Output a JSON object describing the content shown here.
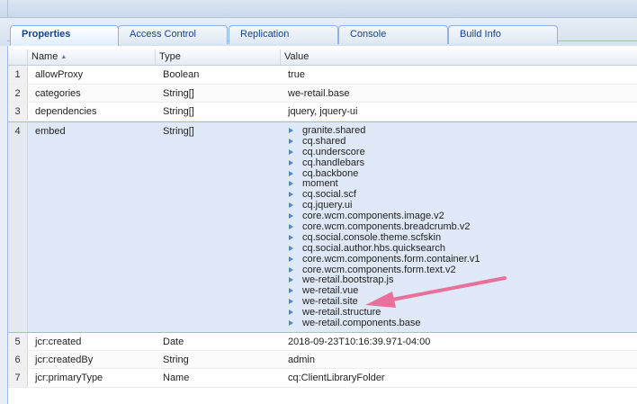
{
  "tabs": [
    {
      "label": "Properties",
      "active": true
    },
    {
      "label": "Access Control"
    },
    {
      "label": "Replication"
    },
    {
      "label": "Console"
    },
    {
      "label": "Build Info"
    }
  ],
  "columns": {
    "name": "Name",
    "type": "Type",
    "value": "Value"
  },
  "rows": [
    {
      "num": "1",
      "name": "allowProxy",
      "type": "Boolean",
      "value": "true"
    },
    {
      "num": "2",
      "name": "categories",
      "type": "String[]",
      "value": "we-retail.base"
    },
    {
      "num": "3",
      "name": "dependencies",
      "type": "String[]",
      "value": "jquery, jquery-ui"
    },
    {
      "num": "4",
      "name": "embed",
      "type": "String[]",
      "values": [
        "granite.shared",
        "cq.shared",
        "cq.underscore",
        "cq.handlebars",
        "cq.backbone",
        "moment",
        "cq.social.scf",
        "cq.jquery.ui",
        "core.wcm.components.image.v2",
        "core.wcm.components.breadcrumb.v2",
        "cq.social.console.theme.scfskin",
        "cq.social.author.hbs.quicksearch",
        "core.wcm.components.form.container.v1",
        "core.wcm.components.form.text.v2",
        "we-retail.bootstrap.js",
        "we-retail.vue",
        "we-retail.site",
        "we-retail.structure",
        "we-retail.components.base"
      ]
    },
    {
      "num": "5",
      "name": "jcr:created",
      "type": "Date",
      "value": "2018-09-23T10:16:39.971-04:00"
    },
    {
      "num": "6",
      "name": "jcr:createdBy",
      "type": "String",
      "value": "admin"
    },
    {
      "num": "7",
      "name": "jcr:primaryType",
      "type": "Name",
      "value": "cq:ClientLibraryFolder"
    }
  ],
  "annotation_color": "#e8709a"
}
